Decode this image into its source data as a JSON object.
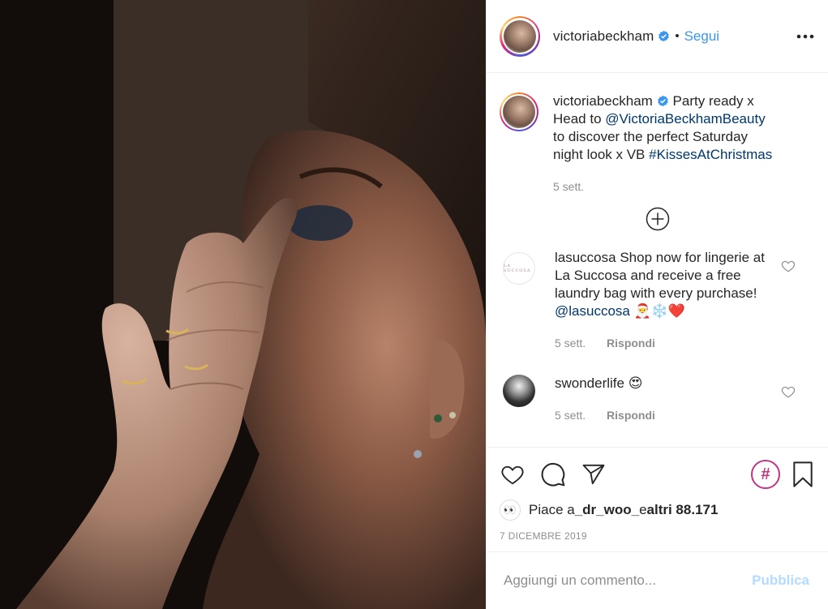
{
  "post": {
    "image_alt": "",
    "author": {
      "username": "victoriabeckham",
      "verified": true,
      "follow_label": "Segui",
      "separator": "•"
    },
    "caption": {
      "username": "victoriabeckham",
      "text_before": " Party ready x Head to ",
      "mention": "@VictoriaBeckhamBeauty",
      "text_middle": " to discover the perfect Saturday night look x VB ",
      "hashtag": "#KissesAtChristmas",
      "time": "5 sett."
    },
    "comments": [
      {
        "username": "lasuccosa",
        "avatar_text": "LA SUCCOSA",
        "text": " Shop now for lingerie at La Succosa and receive a free laundry bag with every purchase! ",
        "mention": "@lasuccosa",
        "emojis": "🎅❄️❤️",
        "time": "5 sett.",
        "reply_label": "Rispondi"
      },
      {
        "username": "swonderlife",
        "text": " ",
        "emojis": "😍",
        "time": "5 sett.",
        "reply_label": "Rispondi"
      }
    ],
    "likes": {
      "prefix": "Piace a ",
      "user": "_dr_woo_",
      "middle": " e ",
      "count_text": "altri 88.171",
      "avatar_glyph": "👀"
    },
    "date": "7 DICEMBRE 2019",
    "hashtag_button": "#"
  },
  "composer": {
    "placeholder": "Aggiungi un commento...",
    "publish_label": "Pubblica"
  },
  "colors": {
    "link": "#00376b",
    "follow": "#3897f0",
    "publish_disabled": "#b3dbff",
    "hashtag_ring": "#c13584"
  },
  "icons": [
    "more-options-icon",
    "verified-icon",
    "add-comments-icon",
    "heart-icon",
    "comment-icon",
    "share-icon",
    "bookmark-icon",
    "hashtag-icon"
  ]
}
